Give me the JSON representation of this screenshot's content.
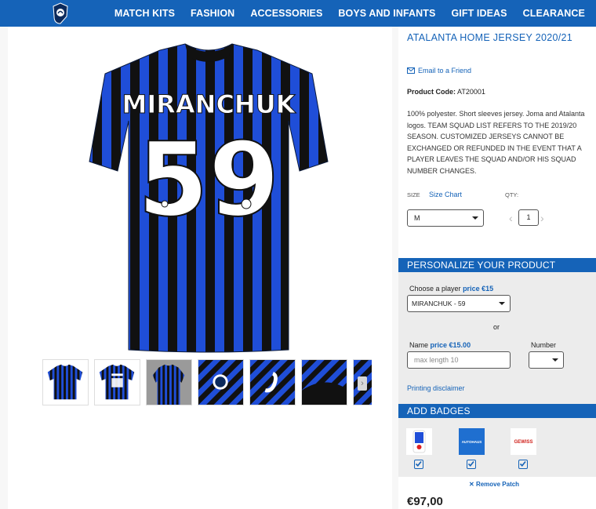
{
  "nav": {
    "items": [
      "MATCH KITS",
      "FASHION",
      "ACCESSORIES",
      "BOYS AND INFANTS",
      "GIFT IDEAS",
      "CLEARANCE"
    ]
  },
  "product": {
    "title": "ATALANTA HOME JERSEY 2020/21",
    "email_link": "Email to a Friend",
    "code_label": "Product Code:",
    "code_value": "AT20001",
    "description": "100% polyester. Short sleeves jersey. Joma and Atalanta logos. TEAM SQUAD LIST REFERS TO THE 2019/20 SEASON. CUSTOMIZED JERSEYS CANNOT BE EXCHANGED OR REFUNDED IN THE EVENT THAT A PLAYER LEAVES THE SQUAD AND/OR HIS SQUAD NUMBER CHANGES.",
    "jersey_name": "MIRANCHUK",
    "jersey_number": "59",
    "price": "€97,00"
  },
  "options": {
    "size_label": "SIZE",
    "size_chart": "Size Chart",
    "qty_label": "QTY:",
    "size_value": "M",
    "qty_value": "1",
    "qty_dec": "‹",
    "qty_inc": "›"
  },
  "personalize": {
    "header": "PERSONALIZE YOUR PRODUCT",
    "choose_label": "Choose a player",
    "choose_price": "price €15",
    "player_value": "MIRANCHUK - 59",
    "or": "or",
    "name_label": "Name",
    "name_price": "price €15.00",
    "name_placeholder": "max length 10",
    "number_label": "Number",
    "disclaimer": "Printing disclaimer"
  },
  "badges": {
    "header": "ADD BADGES",
    "items": [
      {
        "icon": "serie-a-badge-icon"
      },
      {
        "icon": "autohaus-badge-icon",
        "text": "AUTOHAUS"
      },
      {
        "icon": "gewiss-badge-icon",
        "text": "GEWISS"
      }
    ],
    "remove_label": "Remove Patch"
  },
  "colors": {
    "brand_blue": "#1563b8",
    "stripe_blue": "#1f4ed8",
    "stripe_black": "#111111"
  }
}
